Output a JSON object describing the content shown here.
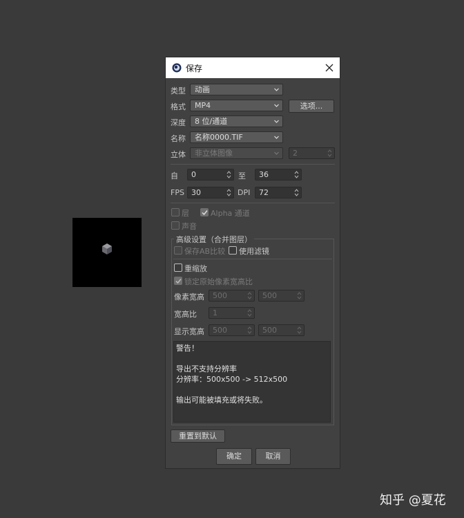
{
  "dialog": {
    "title": "保存",
    "type": {
      "label": "类型",
      "value": "动画"
    },
    "format": {
      "label": "格式",
      "value": "MP4",
      "options_button": "选项..."
    },
    "depth": {
      "label": "深度",
      "value": "8 位/通道"
    },
    "name": {
      "label": "名称",
      "value": "名称0000.TIF"
    },
    "stereo": {
      "label": "立体",
      "value": "非立体图像",
      "count": "2"
    },
    "range": {
      "from_label": "自",
      "from": "0",
      "to_label": "至",
      "to": "36"
    },
    "fps": {
      "label": "FPS",
      "value": "30",
      "dpi_label": "DPI",
      "dpi": "72"
    },
    "layers": {
      "label": "层",
      "checked": false
    },
    "alpha": {
      "label": "Alpha 通道",
      "checked": true
    },
    "sound": {
      "label": "声音",
      "checked": false
    },
    "advanced": {
      "title": "高级设置（合并图层）",
      "save_ab": "保存AB比较",
      "use_filter": "使用滤镜",
      "resize": "重缩放",
      "lock_ratio": "锁定原始像素宽高比",
      "pixel_size": {
        "label": "像素宽高",
        "w": "500",
        "h": "500"
      },
      "aspect": {
        "label": "宽高比",
        "value": "1"
      },
      "display_size": {
        "label": "显示宽高",
        "w": "500",
        "h": "500"
      },
      "warning_lines": [
        "警告！",
        "",
        "导出不支持分辨率",
        "分辨率：500x500 -> 512x500",
        "",
        "输出可能被填充或将失败。"
      ]
    },
    "reset_button": "重置到默认",
    "ok_button": "确定",
    "cancel_button": "取消"
  },
  "watermark": "知乎 @夏花"
}
